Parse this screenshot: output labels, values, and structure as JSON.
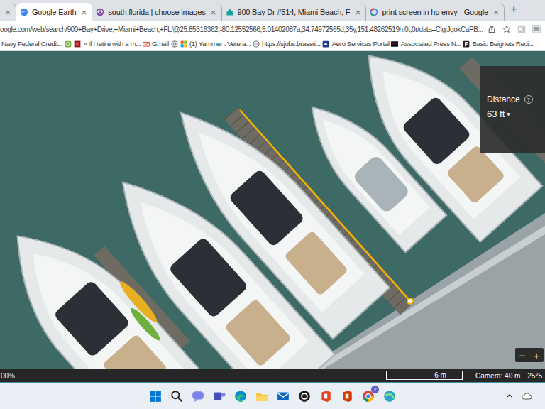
{
  "browser": {
    "tabs": [
      {
        "label": "",
        "selected": false
      },
      {
        "label": "Google Earth",
        "selected": true
      },
      {
        "label": "south florida | choose images",
        "selected": false
      },
      {
        "label": "900 Bay Dr #514, Miami Beach, F",
        "selected": false
      },
      {
        "label": "print screen in hp envy - Google",
        "selected": false
      }
    ],
    "close": "×",
    "new_tab": "+",
    "url": "oogle.com/web/search/900+Bay+Drive,+Miami+Beach,+FL/@25.85316362,-80.12552566,5.01402087a,34.74972565d,35y,151.48262519h,0t,0r/data=CigiJgokCaPB...",
    "bookmarks": [
      {
        "label": "Navy Federal Credit..."
      },
      {
        "label": ""
      },
      {
        "label": "» If I retire with a m..."
      },
      {
        "label": "Gmail"
      },
      {
        "label": ""
      },
      {
        "label": "(1) Yammer : Vetera..."
      },
      {
        "label": "https://sjobs.brassri..."
      },
      {
        "label": "Aero Services Portal"
      },
      {
        "label": "Associated Press N..."
      },
      {
        "label": "Basic Beignets Reci..."
      }
    ]
  },
  "map": {
    "distance": {
      "label": "Distance",
      "help": "?",
      "value": "63 ft",
      "caret": "▾"
    },
    "zoom": [
      "−",
      "+"
    ],
    "status": {
      "progress": "00%",
      "scale": "6 m",
      "camera": "Camera: 40 m",
      "coords": "25°5"
    }
  },
  "taskbar": {
    "notification_badge": "2"
  }
}
